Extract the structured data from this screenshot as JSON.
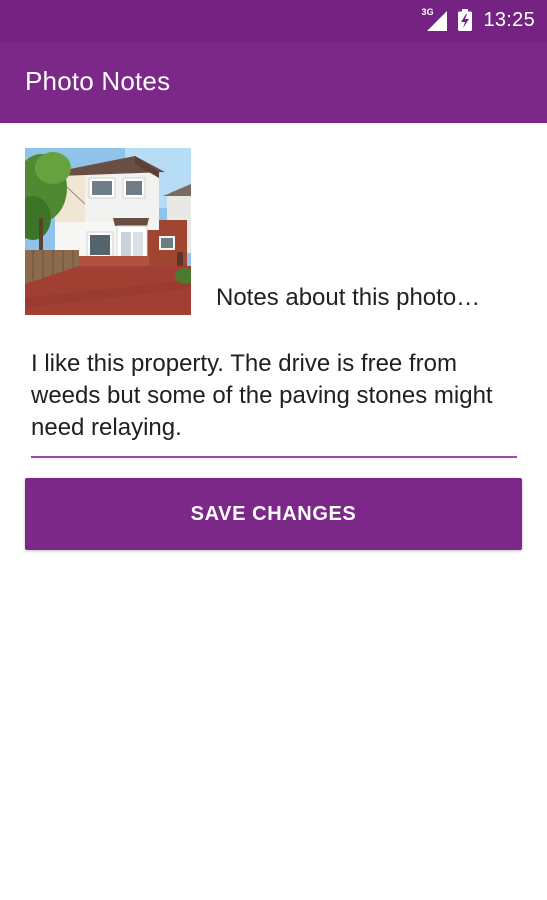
{
  "status_bar": {
    "network": "3G",
    "time": "13:25",
    "icons": [
      "signal-icon",
      "battery-charging-icon"
    ]
  },
  "app_bar": {
    "title": "Photo Notes"
  },
  "photo": {
    "description_icon": "house-photo"
  },
  "caption": "Notes about this photo…",
  "notes": {
    "value": "I like this property. The drive is free from weeds but some of the paving stones might need relaying."
  },
  "actions": {
    "save_label": "SAVE CHANGES"
  },
  "colors": {
    "status_bar": "#742383",
    "app_bar": "#7b2888",
    "accent": "#9a4ba6",
    "background": "#ffffff",
    "text": "#202020"
  }
}
